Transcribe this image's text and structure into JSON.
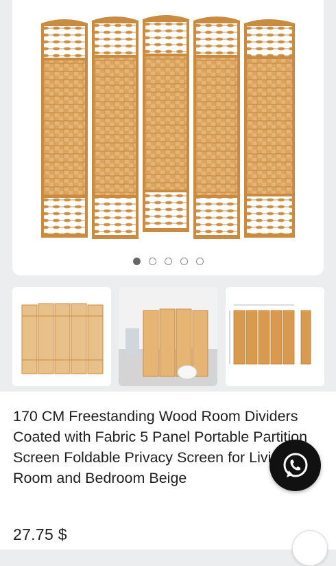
{
  "product": {
    "title": "170 CM Freestanding Wood Room Dividers Coated with Fabric 5 Panel Portable Partition Screen Foldable Privacy Screen for Living Room and Bedroom Beige",
    "price": "27.75 $"
  },
  "gallery": {
    "dots": 5,
    "active_index": 0,
    "thumbnails": [
      "divider-plain",
      "divider-in-room",
      "divider-dimensions"
    ]
  },
  "icons": {
    "whatsapp": "whatsapp-icon",
    "fab": "chevron-up-icon"
  },
  "colors": {
    "wood": "#d6a15c",
    "frame": "#c98b3f",
    "whatsapp_bg": "#111111"
  }
}
